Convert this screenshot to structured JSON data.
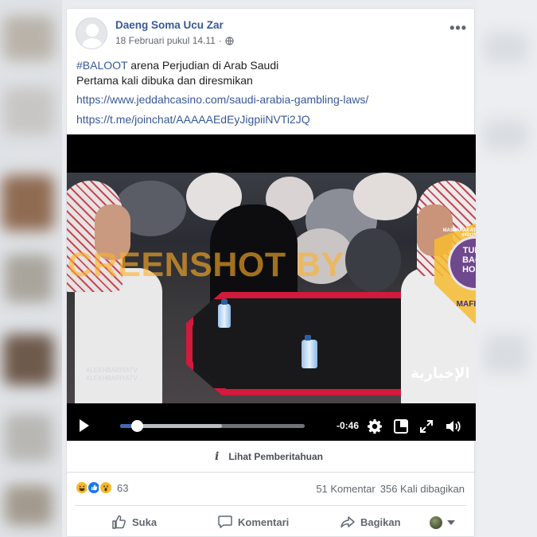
{
  "post": {
    "author": "Daeng Soma Ucu Zar",
    "timestamp": "18 Februari pukul 14.11",
    "privacy_icon": "globe-icon",
    "more_icon": "more-options-icon",
    "hashtag": "#BALOOT",
    "text_line1_rest": " arena Perjudian di Arab Saudi",
    "text_line2": "Pertama kali dibuka dan diresmikan",
    "link1": "https://www.jeddahcasino.com/saudi-arabia-gambling-laws/",
    "link2": "https://t.me/joinchat/AAAAAEdEyJigpiiNVTi2JQ"
  },
  "video": {
    "watermark": "SCREENSHOT BY",
    "badge_top": "MASYARAKAT ANTI FITNAH INDONESIA",
    "badge_logo_line1": "TURN",
    "badge_logo_line2": "BACK",
    "badge_logo_line3": "HOAX",
    "badge_bottom": "MAFINDO",
    "channel_line1": "ALEKHBARIYATV",
    "channel_line2": "ALEKHBARIYATV",
    "channel_logo": "الإخبارية",
    "time_remaining": "-0:46",
    "progress_played": 0.09,
    "progress_buffered": 0.55,
    "controls": {
      "play": "play-icon",
      "settings": "gear-icon",
      "theater": "theater-mode-icon",
      "fullscreen": "fullscreen-icon",
      "volume": "volume-icon"
    }
  },
  "notice": {
    "label": "Lihat Pemberitahuan",
    "icon": "info-icon"
  },
  "engagement": {
    "reactions": [
      "haha",
      "like",
      "wow"
    ],
    "reaction_count": "63",
    "comments": "51 Komentar",
    "shares": "356 Kali dibagikan"
  },
  "actions": {
    "like": "Suka",
    "comment": "Komentari",
    "share": "Bagikan"
  },
  "colors": {
    "link": "#385898",
    "accent": "#4267b2",
    "table_rim": "#d11a3c",
    "watermark": "#ffb028"
  }
}
